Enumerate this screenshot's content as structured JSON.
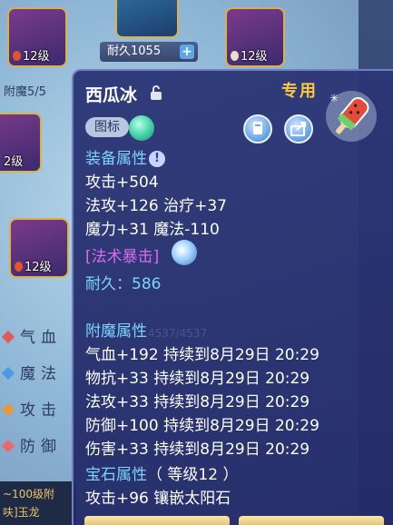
{
  "background": {
    "slots": [
      {
        "level": "12级"
      },
      {
        "level": "12级"
      },
      {
        "level": "2级"
      },
      {
        "level": "12级"
      }
    ],
    "durability_label": "耐久1055",
    "durability_plus": "+",
    "enchant_count": "附魔5/5",
    "stat_menu": [
      "气血",
      "魔法",
      "攻击",
      "防御"
    ],
    "chat_lines": [
      "~100级附",
      "呋]玉龙"
    ]
  },
  "tooltip": {
    "name": "西瓜冰",
    "special_tag": "专用",
    "marker_label": "图标",
    "equip_section": "装备属性",
    "equip_lines": [
      "攻击+504",
      "法攻+126 治疗+37",
      "魔力+31 魔法-110"
    ],
    "magic_crit": "[法术暴击]",
    "durability": "耐久：586",
    "ghost_value": "4537/4537",
    "enchant_section": "附魔属性",
    "enchant_lines": [
      "气血+192 持续到8月29日 20:29",
      "物抗+33 持续到8月29日 20:29",
      "法攻+33 持续到8月29日 20:29",
      "防御+100 持续到8月29日 20:29",
      "伤害+33 持续到8月29日 20:29"
    ],
    "gem_section": "宝石属性",
    "gem_level": "（ 等级12 ）",
    "gem_line": "攻击+96 镶嵌太阳石"
  },
  "colors": {
    "section": "#7ad4ff",
    "special": "#ffc73a",
    "crit": "#d86cf0",
    "panel": "#2c3676"
  },
  "icons": {
    "lock": "lock-icon",
    "info": "info-icon",
    "share": "share-icon",
    "document": "document-icon",
    "item": "watermelon-popsicle-icon"
  }
}
